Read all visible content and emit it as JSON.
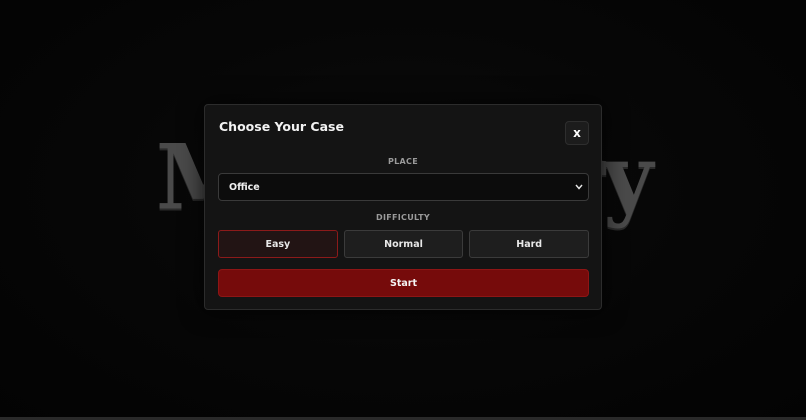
{
  "background": {
    "logo_left_fragment": "M",
    "logo_right_fragment": "ry",
    "logo_color": "#4a4a4a"
  },
  "modal": {
    "title": "Choose Your Case",
    "close_label": "x",
    "place": {
      "label": "PLACE",
      "selected": "Office"
    },
    "difficulty": {
      "label": "DIFFICULTY",
      "options": [
        "Easy",
        "Normal",
        "Hard"
      ],
      "selected": "Easy"
    },
    "start_label": "Start"
  },
  "colors": {
    "accent_red": "#760b0b",
    "selected_border": "#8c1a1a",
    "modal_bg": "#141414"
  }
}
